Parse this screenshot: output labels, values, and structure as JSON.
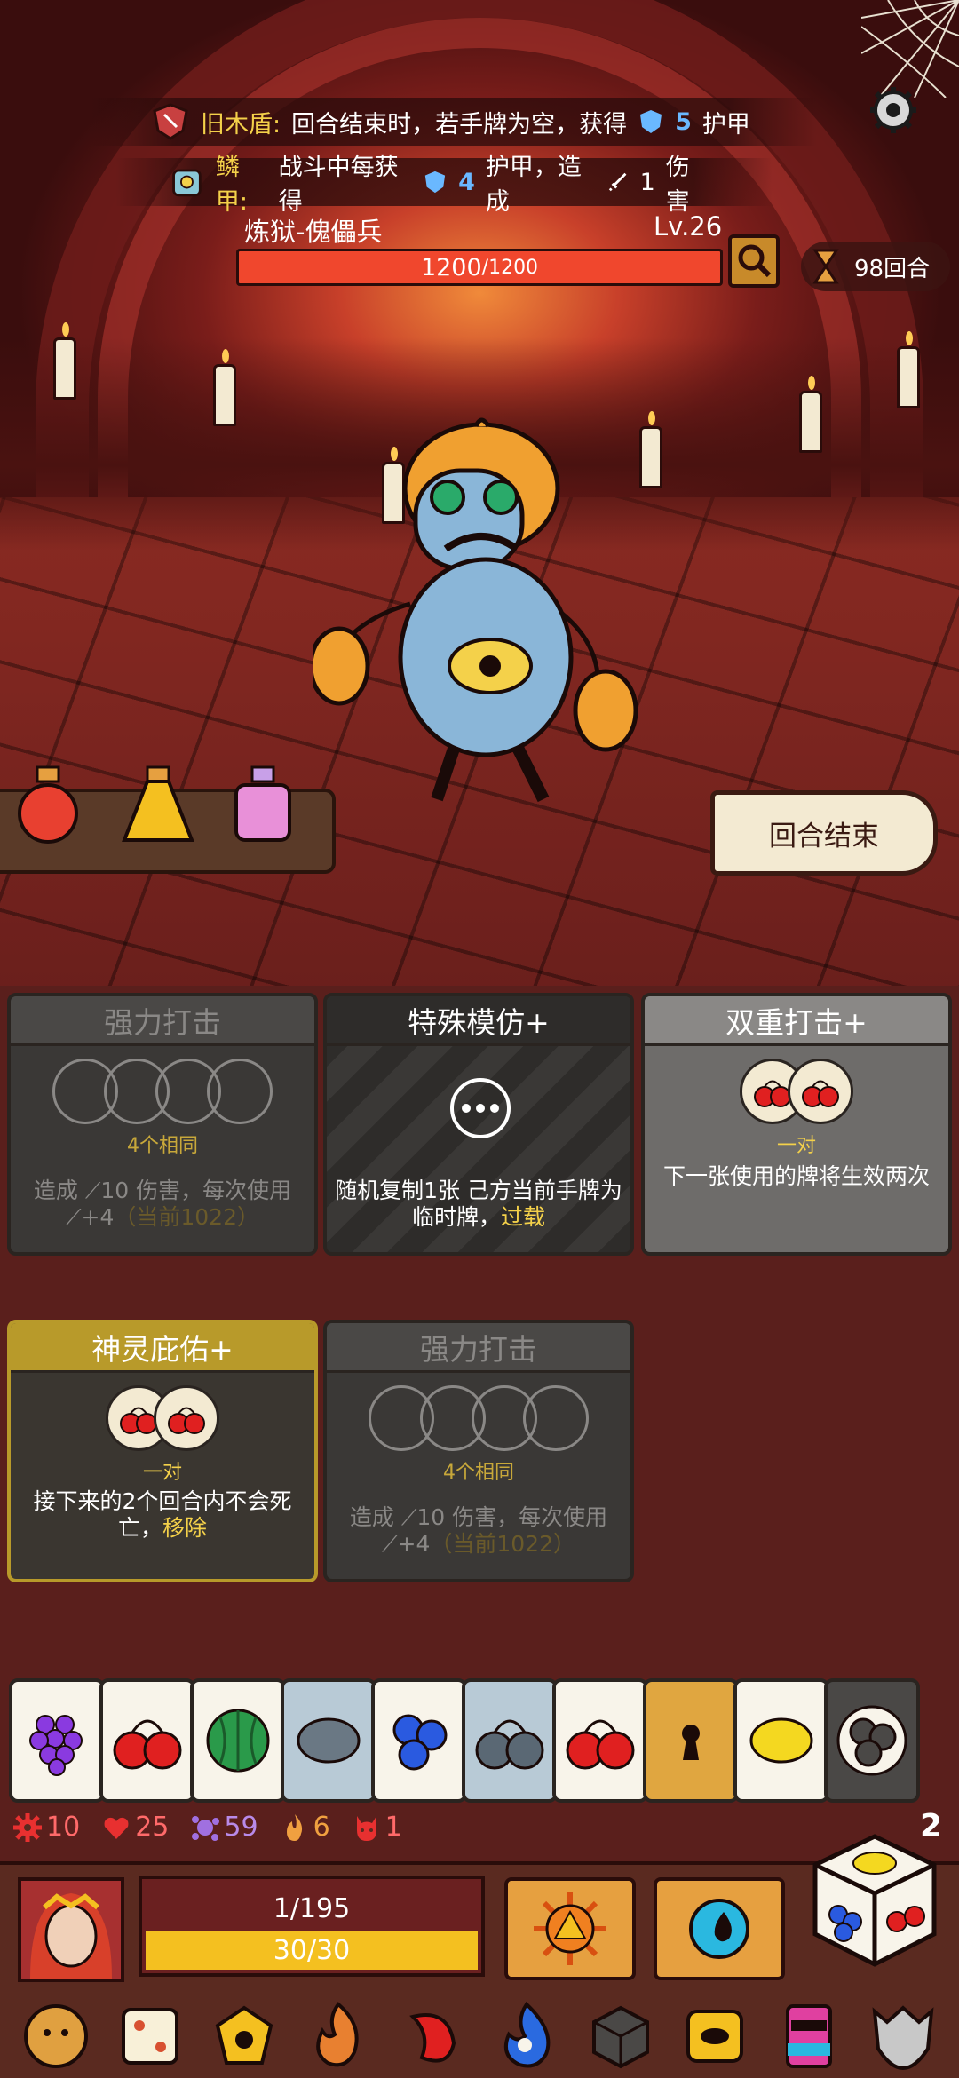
{
  "relics_top": [
    {
      "name": "旧木盾:",
      "desc_pre": "回合结束时，若手牌为空，获得",
      "value": "5",
      "desc_post": "护甲"
    },
    {
      "name": "鳞甲:",
      "desc_pre": "战斗中每获得",
      "value": "4",
      "desc_mid": "护甲，造成",
      "value2": "1",
      "desc_post": "伤害"
    }
  ],
  "enemy": {
    "name": "炼狱-傀儡兵",
    "level": "Lv.26",
    "hp_current": "1200",
    "hp_max": " /1200"
  },
  "turn": {
    "label": "98回合"
  },
  "end_turn_button": "回合结束",
  "cards": [
    {
      "title": "强力打击",
      "combo": "4个相同",
      "effect_pre": "造成",
      "damage": "10",
      "effect_mid": "伤害，每次使用",
      "bonus": "+4",
      "current": "（当前1022）"
    },
    {
      "title": "特殊模仿+",
      "effect_pre": "随机复制1张 己方当前手牌为临时牌，",
      "keyword": "过载"
    },
    {
      "title": "双重打击+",
      "combo": "一对",
      "effect": "下一张使用的牌将生效两次"
    },
    {
      "title": "神灵庇佑+",
      "combo": "一对",
      "effect_pre": "接下来的2个回合内不会死亡，",
      "keyword": "移除"
    },
    {
      "title": "强力打击",
      "combo": "4个相同",
      "effect_pre": "造成",
      "damage": "10",
      "effect_mid": "伤害，每次使用",
      "bonus": "+4",
      "current": "（当前1022）"
    }
  ],
  "dice": [
    "grape-icon",
    "cherry-icon",
    "watermelon-icon",
    "lemon-icon",
    "blueberry-icon",
    "cherry-icon",
    "cherry-icon",
    "lock-icon",
    "lemon-icon",
    "blueberry-icon"
  ],
  "stats": [
    {
      "icon": "gear-burst-icon",
      "value": "10"
    },
    {
      "icon": "heart-wing-icon",
      "value": "25"
    },
    {
      "icon": "splat-icon",
      "value": "59"
    },
    {
      "icon": "flame-icon",
      "value": "6"
    },
    {
      "icon": "devil-icon",
      "value": "1"
    }
  ],
  "reroll_count": "2",
  "player": {
    "hp": "1/195",
    "energy": "30/30"
  },
  "colors": {
    "hp_bar": "#f0472d",
    "energy_bar": "#f4c020",
    "highlight": "#f4d14a",
    "armor": "#6ab8ff"
  }
}
